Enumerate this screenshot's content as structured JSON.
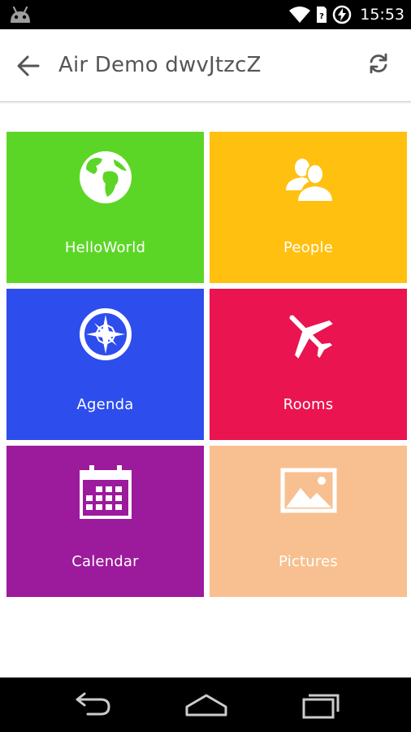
{
  "status_bar": {
    "time": "15:53",
    "icons": [
      "android-icon",
      "wifi-icon",
      "no-sim-icon",
      "battery-charging-icon"
    ]
  },
  "app_bar": {
    "title": "Air Demo dwvJtzcZ",
    "back_icon": "arrow-back-icon",
    "refresh_icon": "refresh-icon"
  },
  "tiles": [
    {
      "label": "HelloWorld",
      "icon": "globe-icon",
      "color": "#5cd626"
    },
    {
      "label": "People",
      "icon": "people-icon",
      "color": "#ffc010"
    },
    {
      "label": "Agenda",
      "icon": "compass-icon",
      "color": "#2e4ded"
    },
    {
      "label": "Rooms",
      "icon": "airplane-icon",
      "color": "#ea1450"
    },
    {
      "label": "Calendar",
      "icon": "calendar-icon",
      "color": "#9c1a9c"
    },
    {
      "label": "Pictures",
      "icon": "picture-icon",
      "color": "#f8c090"
    }
  ],
  "nav_bar": {
    "buttons": [
      "back-nav-icon",
      "home-icon",
      "recent-apps-icon"
    ]
  }
}
